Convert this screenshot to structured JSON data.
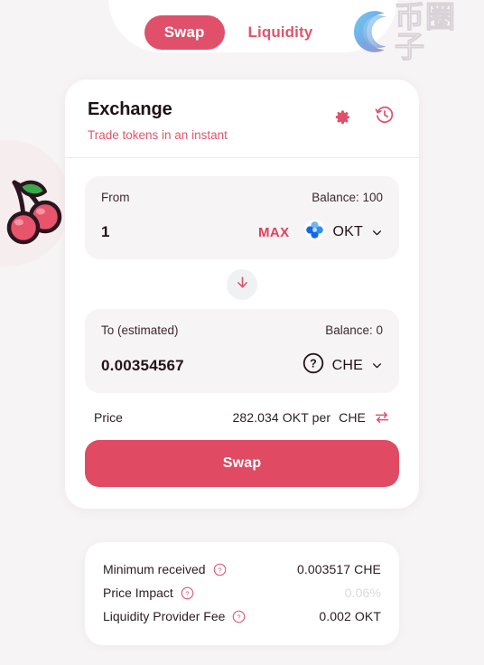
{
  "nav": {
    "tabs": [
      {
        "label": "Swap",
        "active": true
      },
      {
        "label": "Liquidity",
        "active": false
      }
    ]
  },
  "watermark": {
    "characters": "币圈子",
    "icon": "swirl-c-logo"
  },
  "brand": {
    "icon": "cherry-logo"
  },
  "exchange": {
    "title": "Exchange",
    "subtitle": "Trade tokens in an instant",
    "settings_icon": "gear-icon",
    "history_icon": "history-icon"
  },
  "from": {
    "label": "From",
    "balance": "Balance: 100",
    "amount": "1",
    "max_label": "MAX",
    "token": "OKT",
    "token_icon": "okt-token-icon",
    "chevron_icon": "chevron-down-icon"
  },
  "switch": {
    "icon": "arrow-down-icon"
  },
  "to": {
    "label": "To (estimated)",
    "balance": "Balance: 0",
    "amount": "0.00354567",
    "token": "CHE",
    "token_icon": "question-token-icon",
    "chevron_icon": "chevron-down-icon"
  },
  "price": {
    "label": "Price",
    "value": "282.034 OKT per",
    "unit": "CHE",
    "swap_icon": "swap-arrows-icon"
  },
  "action": {
    "swap_label": "Swap"
  },
  "details": {
    "rows": [
      {
        "label": "Minimum received",
        "value": "0.003517  CHE",
        "help_icon": "question-icon",
        "muted": false
      },
      {
        "label": "Price Impact",
        "value": "0.06%",
        "help_icon": "question-icon",
        "muted": true
      },
      {
        "label": "Liquidity Provider Fee",
        "value": "0.002 OKT",
        "help_icon": "question-icon",
        "muted": false
      }
    ]
  },
  "colors": {
    "accent": "#e04a62",
    "accent_text": "#e0556b",
    "background": "#f7f4f5",
    "card": "#ffffff",
    "panel": "#f7f4f5",
    "text_dark": "#231319",
    "muted": "#dcd9da"
  }
}
